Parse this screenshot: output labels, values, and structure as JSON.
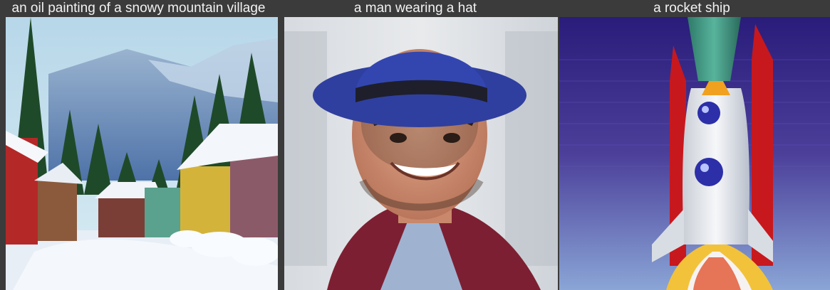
{
  "panels": [
    {
      "caption": "an oil painting of a snowy mountain village",
      "image": "snowy-mountain-village-painting"
    },
    {
      "caption": "a man wearing a hat",
      "image": "smiling-man-in-blue-hat"
    },
    {
      "caption": "a rocket ship",
      "image": "cartoon-rocket-ship-launch"
    }
  ],
  "colors": {
    "background": "#3b3b3b",
    "caption_text": "#f2f2f2",
    "hat_blue": "#2f3f9f",
    "rocket_red": "#c7181e",
    "sky_purple": "#4b3f9a"
  }
}
